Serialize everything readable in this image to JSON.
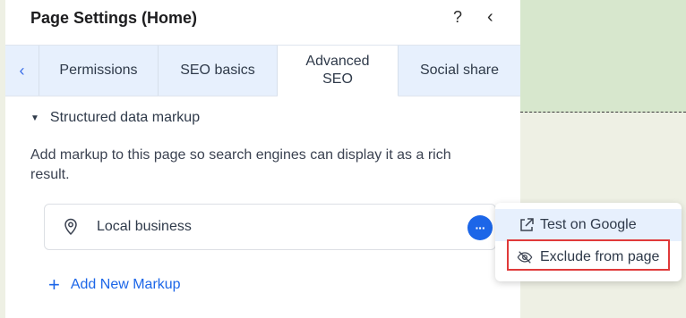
{
  "panel": {
    "title": "Page Settings (Home)",
    "help_label": "?",
    "back_label": "‹"
  },
  "tabs": {
    "scroll_left_label": "‹",
    "items": [
      {
        "label": "Permissions"
      },
      {
        "label": "SEO basics"
      },
      {
        "label": "Advanced SEO",
        "active": true
      },
      {
        "label": "Social share"
      }
    ]
  },
  "section": {
    "toggle_label": "Structured data markup",
    "description": "Add markup to this page so search engines can display it as a rich result."
  },
  "markup_list": [
    {
      "label": "Local business",
      "icon": "location-pin-icon"
    }
  ],
  "more_label": "···",
  "add_markup_label": "Add New Markup",
  "context_menu": {
    "items": [
      {
        "label": "Test on Google",
        "icon": "external-link-icon"
      },
      {
        "label": "Exclude from page",
        "icon": "eye-off-icon"
      }
    ]
  },
  "colors": {
    "accent": "#1c66e8",
    "tab_bar": "#e7f0fd",
    "highlight": "#e03a3a",
    "canvas_top": "#d7e7cd",
    "canvas_bottom": "#eef0e4"
  }
}
